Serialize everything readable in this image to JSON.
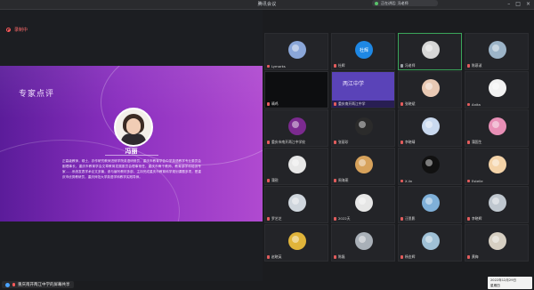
{
  "window": {
    "title": "腾讯会议"
  },
  "speaker_pill": {
    "text": "正在讲话: 冯老师"
  },
  "recording": {
    "label": "录制中"
  },
  "slide": {
    "title": "专家点评",
    "name": "冯丽",
    "bio": "正高级教师，硕士，亦作研究教师进修学院英语研修员，重庆市教育学会中学英语教学专业委员会副理事长，重庆市教育学会文章教育发展委员会理事常任，重庆市骨干教师，教育部学科培训专家……系统发表学术论文多篇，参与编写教材多部，主持完成重庆市教育科学规划课题多项，是重庆市优秀教研员，重庆师范大学英语学科教学实践导师。"
  },
  "bottom_tab": {
    "label": "重庆南开两江中学的屏幕共享"
  },
  "participants": [
    {
      "name": "Lymorks",
      "color": "#8aa6d8",
      "mic": "off"
    },
    {
      "name": "杜辉",
      "color": "#1e88e5",
      "mic": "off",
      "avatar_text": "杜辉"
    },
    {
      "name": "冯老师",
      "color": "#d7d7d7",
      "mic": "on",
      "speaking": true
    },
    {
      "name": "陈慕淑",
      "color": "#9cb4c8",
      "mic": "off"
    },
    {
      "name": "晴鸡",
      "color": "#000000",
      "mic": "off",
      "dark": true
    },
    {
      "name": "重庆南开两江中学",
      "banner": true,
      "banner_text": "两江中学",
      "mic": "off"
    },
    {
      "name": "张晓斌",
      "color": "#e9c9b4",
      "mic": "off"
    },
    {
      "name": "Anita",
      "color": "#f2f2f2",
      "mic": "off"
    },
    {
      "name": "重庆市南开两江中学校",
      "color": "#7b2a8f",
      "mic": "off"
    },
    {
      "name": "张丽珍",
      "color": "#2b2b2b",
      "mic": "off"
    },
    {
      "name": "李晓晴",
      "color": "#c9d9ef",
      "mic": "off"
    },
    {
      "name": "蒲国生",
      "color": "#e88fb6",
      "mic": "off"
    },
    {
      "name": "蒲锐",
      "color": "#e7e7e7",
      "mic": "off"
    },
    {
      "name": "周海燕",
      "color": "#d7a25b",
      "mic": "off"
    },
    {
      "name": "X.lin",
      "color": "#111111",
      "mic": "off"
    },
    {
      "name": "Estelle",
      "color": "#f4d3a8",
      "mic": "off"
    },
    {
      "name": "罗艺芝",
      "color": "#cfd6dd",
      "mic": "off"
    },
    {
      "name": "2022天",
      "color": "#e6e6e6",
      "mic": "off"
    },
    {
      "name": "汪思影",
      "color": "#7fb0d9",
      "mic": "off"
    },
    {
      "name": "李晓辉",
      "color": "#bfc7cf",
      "mic": "off"
    },
    {
      "name": "赵晓英",
      "color": "#e0b43a",
      "mic": "off"
    },
    {
      "name": "陈磊",
      "color": "#a9b0b8",
      "mic": "off"
    },
    {
      "name": "杨金辉",
      "color": "#9fc0d6",
      "mic": "off"
    },
    {
      "name": "黄梅",
      "color": "#d6cfc2",
      "mic": "off"
    }
  ],
  "clock": {
    "date": "2022年12月29日",
    "weekday": "星期四"
  }
}
